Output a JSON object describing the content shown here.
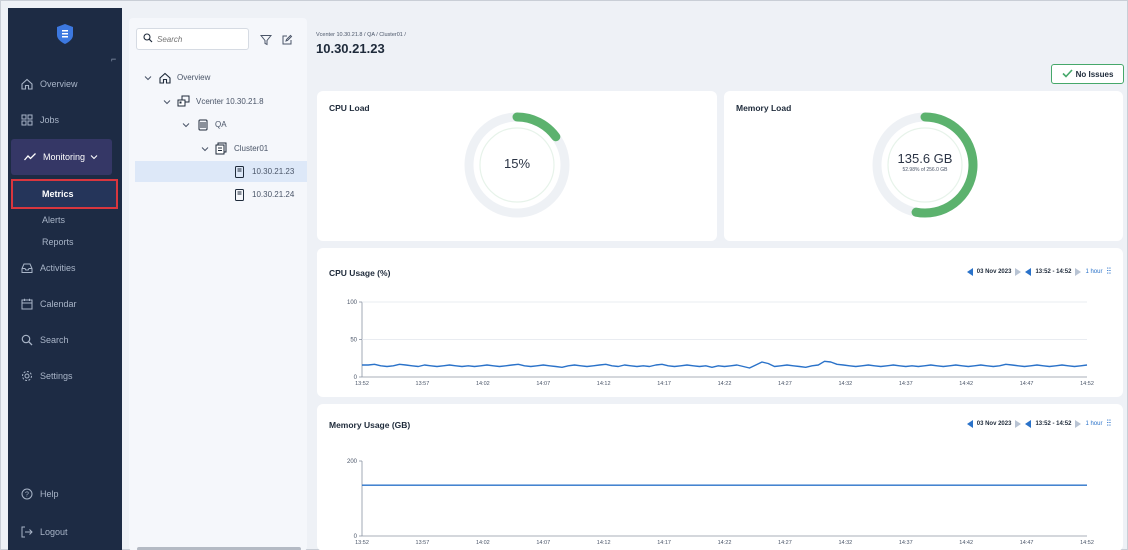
{
  "sidebar": {
    "items": [
      {
        "label": "Overview",
        "icon": "home-icon"
      },
      {
        "label": "Jobs",
        "icon": "grid-icon"
      },
      {
        "label": "Monitoring",
        "icon": "pulse-icon"
      },
      {
        "label": "Activities",
        "icon": "inbox-icon"
      },
      {
        "label": "Calendar",
        "icon": "calendar-icon"
      },
      {
        "label": "Search",
        "icon": "search-icon"
      },
      {
        "label": "Settings",
        "icon": "gear-icon"
      }
    ],
    "monitoring_sub": [
      "Metrics",
      "Alerts",
      "Reports"
    ],
    "help": "Help",
    "logout": "Logout",
    "colors": {
      "background": "#1d2b44",
      "active": "#353766",
      "highlight_border": "#d9363e"
    }
  },
  "tree": {
    "search_placeholder": "Search",
    "nodes": [
      "Overview",
      "Vcenter 10.30.21.8",
      "QA",
      "Cluster01",
      "10.30.21.23",
      "10.30.21.24"
    ],
    "selected": "10.30.21.23"
  },
  "header": {
    "breadcrumb": "Vcenter 10.30.21.8 / QA / Cluster01 /",
    "title": "10.30.21.23",
    "status": "No Issues"
  },
  "cpu_load": {
    "title": "CPU Load",
    "value": "15%",
    "percent": 15
  },
  "memory_load": {
    "title": "Memory Load",
    "value": "135.6 GB",
    "sub": "52.98% of 256.0 GB",
    "percent": 52.98
  },
  "time_control": {
    "date": "03 Nov 2023",
    "range": "13:52 - 14:52",
    "span": "1 hour"
  },
  "colors": {
    "accent": "#2a72c9",
    "gauge": "#5cb26e",
    "line": "#2a72c9",
    "status_border": "#46a86a"
  },
  "chart_data": [
    {
      "type": "line",
      "title": "CPU Usage (%)",
      "xlabel": "",
      "ylabel": "",
      "ylim": [
        0,
        100
      ],
      "yticks": [
        0,
        50,
        100
      ],
      "xticks": [
        "13:52",
        "13:57",
        "14:02",
        "14:07",
        "14:12",
        "14:17",
        "14:22",
        "14:27",
        "14:32",
        "14:37",
        "14:42",
        "14:47",
        "14:52"
      ],
      "grid": "horizontal",
      "series": [
        {
          "values": [
            16,
            16,
            17,
            15,
            14,
            15,
            17,
            16,
            15,
            14,
            16,
            15,
            14,
            15,
            16,
            15,
            14,
            15,
            14,
            15,
            16,
            15,
            14,
            15,
            16,
            17,
            15,
            14,
            15,
            16,
            15,
            14,
            13,
            15,
            16,
            15,
            14,
            15,
            16,
            17,
            15,
            14,
            16,
            15,
            14,
            15,
            14,
            16,
            17,
            15,
            14,
            15,
            16,
            15,
            14,
            15,
            13,
            15,
            14,
            15,
            16,
            14,
            12,
            16,
            20,
            18,
            14,
            15,
            16,
            15,
            14,
            13,
            15,
            16,
            21,
            20,
            17,
            16,
            15,
            14,
            15,
            16,
            15,
            14,
            15,
            16,
            15,
            14,
            15,
            14,
            15,
            16,
            15,
            14,
            15,
            16,
            15,
            14,
            15,
            16,
            15,
            14,
            15,
            17,
            16,
            15,
            14,
            15,
            16,
            15,
            14,
            15,
            16,
            15,
            14,
            15,
            16
          ]
        }
      ]
    },
    {
      "type": "line",
      "title": "Memory Usage (GB)",
      "xlabel": "",
      "ylabel": "",
      "ylim": [
        0,
        200
      ],
      "yticks": [
        0,
        200
      ],
      "xticks": [
        "13:52",
        "13:57",
        "14:02",
        "14:07",
        "14:12",
        "14:17",
        "14:22",
        "14:27",
        "14:32",
        "14:37",
        "14:42",
        "14:47",
        "14:52"
      ],
      "grid": "none",
      "series": [
        {
          "values": [
            135.6,
            135.6
          ]
        }
      ]
    }
  ]
}
